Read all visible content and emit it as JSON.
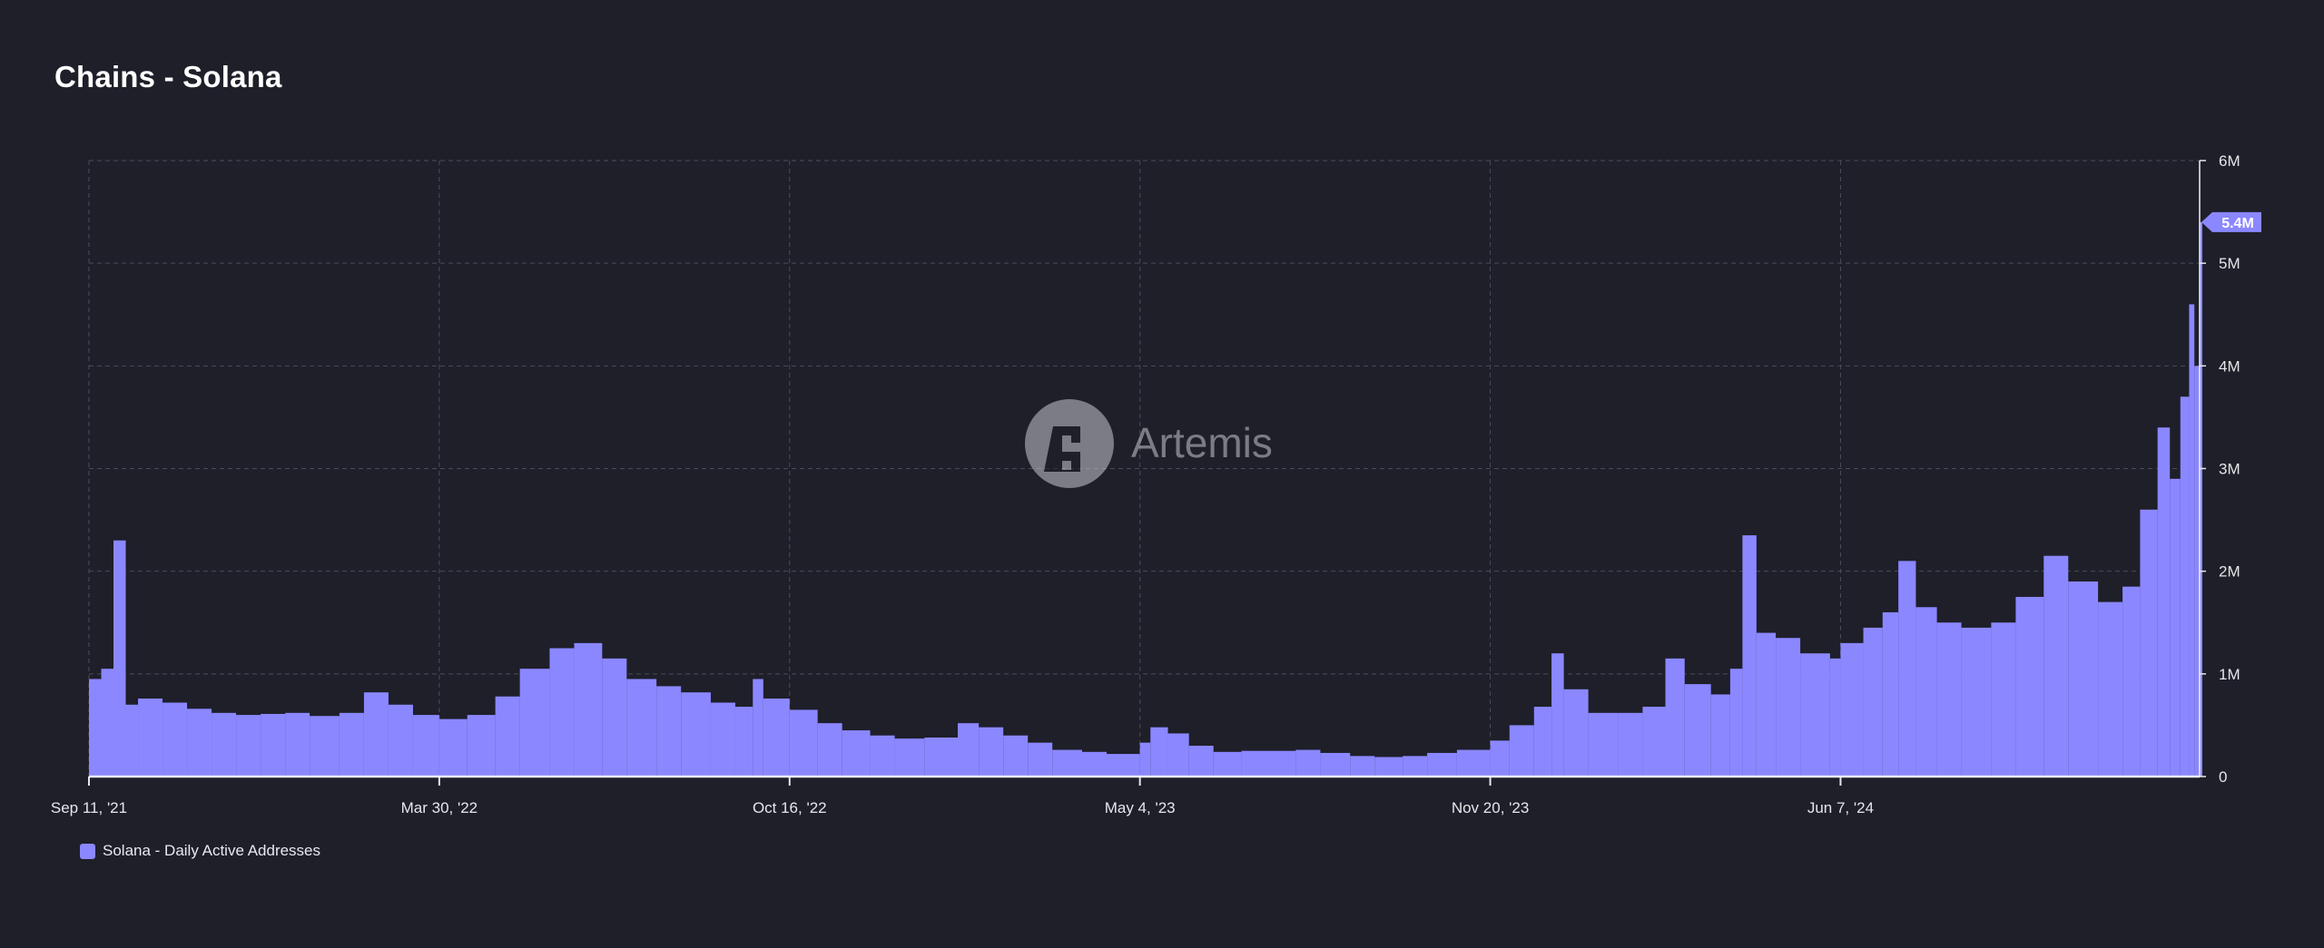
{
  "title": "Chains - Solana",
  "watermark": {
    "text": "Artemis",
    "icon": "artemis-logo-icon"
  },
  "colors": {
    "background": "#1e1f29",
    "series": "#8b87ff",
    "grid": "#4a4c5a",
    "text": "#e6e6ea"
  },
  "legend": {
    "label": "Solana - Daily Active Addresses",
    "placement": "bottom-left"
  },
  "last_value_badge": "5.4M",
  "chart_data": {
    "type": "bar",
    "title": "Chains - Solana",
    "xlabel": "",
    "ylabel": "",
    "grid": true,
    "y_axis_side": "right",
    "x_range": [
      "2021-09-11",
      "2024-12-29"
    ],
    "ylim": [
      0,
      6000000
    ],
    "y_ticks": [
      {
        "value": 0,
        "label": "0"
      },
      {
        "value": 1000000,
        "label": "1M"
      },
      {
        "value": 2000000,
        "label": "2M"
      },
      {
        "value": 3000000,
        "label": "3M"
      },
      {
        "value": 4000000,
        "label": "4M"
      },
      {
        "value": 5000000,
        "label": "5M"
      },
      {
        "value": 6000000,
        "label": "6M"
      }
    ],
    "x_ticks": [
      {
        "date": "2021-09-11",
        "label": "Sep 11, '21"
      },
      {
        "date": "2022-03-30",
        "label": "Mar 30, '22"
      },
      {
        "date": "2022-10-16",
        "label": "Oct 16, '22"
      },
      {
        "date": "2023-05-04",
        "label": "May 4, '23"
      },
      {
        "date": "2023-11-20",
        "label": "Nov 20, '23"
      },
      {
        "date": "2024-06-07",
        "label": "Jun 7, '24"
      }
    ],
    "series": [
      {
        "name": "Solana - Daily Active Addresses",
        "points": [
          [
            "2021-09-11",
            950000
          ],
          [
            "2021-09-18",
            1050000
          ],
          [
            "2021-09-25",
            2300000
          ],
          [
            "2021-10-02",
            700000
          ],
          [
            "2021-10-09",
            760000
          ],
          [
            "2021-10-23",
            720000
          ],
          [
            "2021-11-06",
            660000
          ],
          [
            "2021-11-20",
            620000
          ],
          [
            "2021-12-04",
            600000
          ],
          [
            "2021-12-18",
            610000
          ],
          [
            "2022-01-01",
            620000
          ],
          [
            "2022-01-15",
            590000
          ],
          [
            "2022-02-01",
            620000
          ],
          [
            "2022-02-15",
            820000
          ],
          [
            "2022-03-01",
            700000
          ],
          [
            "2022-03-15",
            600000
          ],
          [
            "2022-03-30",
            560000
          ],
          [
            "2022-04-15",
            600000
          ],
          [
            "2022-05-01",
            780000
          ],
          [
            "2022-05-15",
            1050000
          ],
          [
            "2022-06-01",
            1250000
          ],
          [
            "2022-06-15",
            1300000
          ],
          [
            "2022-07-01",
            1150000
          ],
          [
            "2022-07-15",
            950000
          ],
          [
            "2022-08-01",
            880000
          ],
          [
            "2022-08-15",
            820000
          ],
          [
            "2022-09-01",
            720000
          ],
          [
            "2022-09-15",
            680000
          ],
          [
            "2022-09-25",
            950000
          ],
          [
            "2022-10-01",
            760000
          ],
          [
            "2022-10-16",
            650000
          ],
          [
            "2022-11-01",
            520000
          ],
          [
            "2022-11-15",
            450000
          ],
          [
            "2022-12-01",
            400000
          ],
          [
            "2022-12-15",
            370000
          ],
          [
            "2023-01-01",
            380000
          ],
          [
            "2023-01-20",
            520000
          ],
          [
            "2023-02-01",
            480000
          ],
          [
            "2023-02-15",
            400000
          ],
          [
            "2023-03-01",
            330000
          ],
          [
            "2023-03-15",
            260000
          ],
          [
            "2023-04-01",
            240000
          ],
          [
            "2023-04-15",
            220000
          ],
          [
            "2023-05-04",
            330000
          ],
          [
            "2023-05-10",
            480000
          ],
          [
            "2023-05-20",
            420000
          ],
          [
            "2023-06-01",
            300000
          ],
          [
            "2023-06-15",
            240000
          ],
          [
            "2023-07-01",
            250000
          ],
          [
            "2023-08-01",
            260000
          ],
          [
            "2023-08-15",
            230000
          ],
          [
            "2023-09-01",
            200000
          ],
          [
            "2023-09-15",
            190000
          ],
          [
            "2023-10-01",
            200000
          ],
          [
            "2023-10-15",
            230000
          ],
          [
            "2023-11-01",
            260000
          ],
          [
            "2023-11-20",
            350000
          ],
          [
            "2023-12-01",
            500000
          ],
          [
            "2023-12-15",
            680000
          ],
          [
            "2023-12-25",
            1200000
          ],
          [
            "2024-01-01",
            850000
          ],
          [
            "2024-01-15",
            620000
          ],
          [
            "2024-02-01",
            620000
          ],
          [
            "2024-02-15",
            680000
          ],
          [
            "2024-02-28",
            1150000
          ],
          [
            "2024-03-10",
            900000
          ],
          [
            "2024-03-25",
            800000
          ],
          [
            "2024-04-05",
            1050000
          ],
          [
            "2024-04-12",
            2350000
          ],
          [
            "2024-04-20",
            1400000
          ],
          [
            "2024-05-01",
            1350000
          ],
          [
            "2024-05-15",
            1200000
          ],
          [
            "2024-06-01",
            1150000
          ],
          [
            "2024-06-07",
            1300000
          ],
          [
            "2024-06-20",
            1450000
          ],
          [
            "2024-07-01",
            1600000
          ],
          [
            "2024-07-10",
            2100000
          ],
          [
            "2024-07-20",
            1650000
          ],
          [
            "2024-08-01",
            1500000
          ],
          [
            "2024-08-15",
            1450000
          ],
          [
            "2024-09-01",
            1500000
          ],
          [
            "2024-09-15",
            1750000
          ],
          [
            "2024-10-01",
            2150000
          ],
          [
            "2024-10-15",
            1900000
          ],
          [
            "2024-11-01",
            1700000
          ],
          [
            "2024-11-15",
            1850000
          ],
          [
            "2024-11-25",
            2600000
          ],
          [
            "2024-12-05",
            3400000
          ],
          [
            "2024-12-12",
            2900000
          ],
          [
            "2024-12-18",
            3700000
          ],
          [
            "2024-12-23",
            4600000
          ],
          [
            "2024-12-26",
            4000000
          ],
          [
            "2024-12-29",
            5400000
          ]
        ]
      }
    ]
  }
}
